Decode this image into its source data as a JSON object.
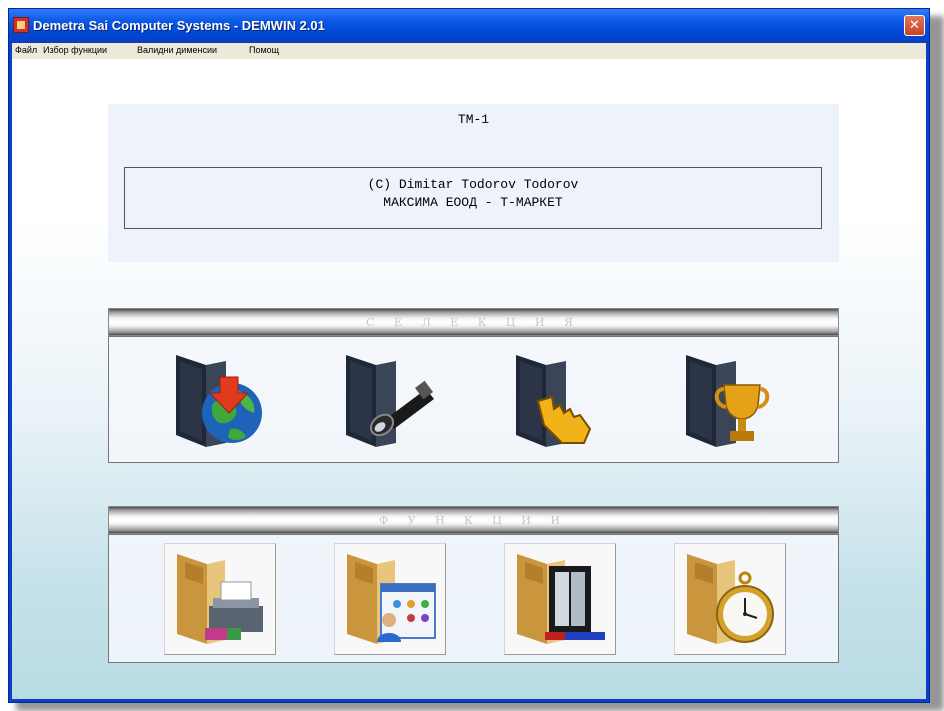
{
  "window": {
    "title": "Demetra Sai Computer Systems - DEMWIN 2.01",
    "close_label": "✕"
  },
  "menu": {
    "items": [
      "Файл",
      "Избор функции",
      "Валидни дименсии",
      "Помощ"
    ]
  },
  "info": {
    "title": "TM-1",
    "copyright": "(C) Dimitar Todorov Todorov",
    "company": "МАКСИМА ЕООД - Т-МАРКЕТ"
  },
  "sections": {
    "selection_title": "С Е Л Е К Ц И Я",
    "selection_items": [
      "globe-download",
      "flashlight",
      "pointer-hand",
      "trophy"
    ],
    "functions_title": "Ф У Н К Ц И И",
    "functions_items": [
      "printer",
      "user-dashboard",
      "film-window",
      "pocket-watch"
    ]
  },
  "colors": {
    "title_bar": "#0c5ae6",
    "close_button": "#d4543a",
    "menu_bg": "#ece9d8",
    "info_bg": "#eef2fb"
  }
}
